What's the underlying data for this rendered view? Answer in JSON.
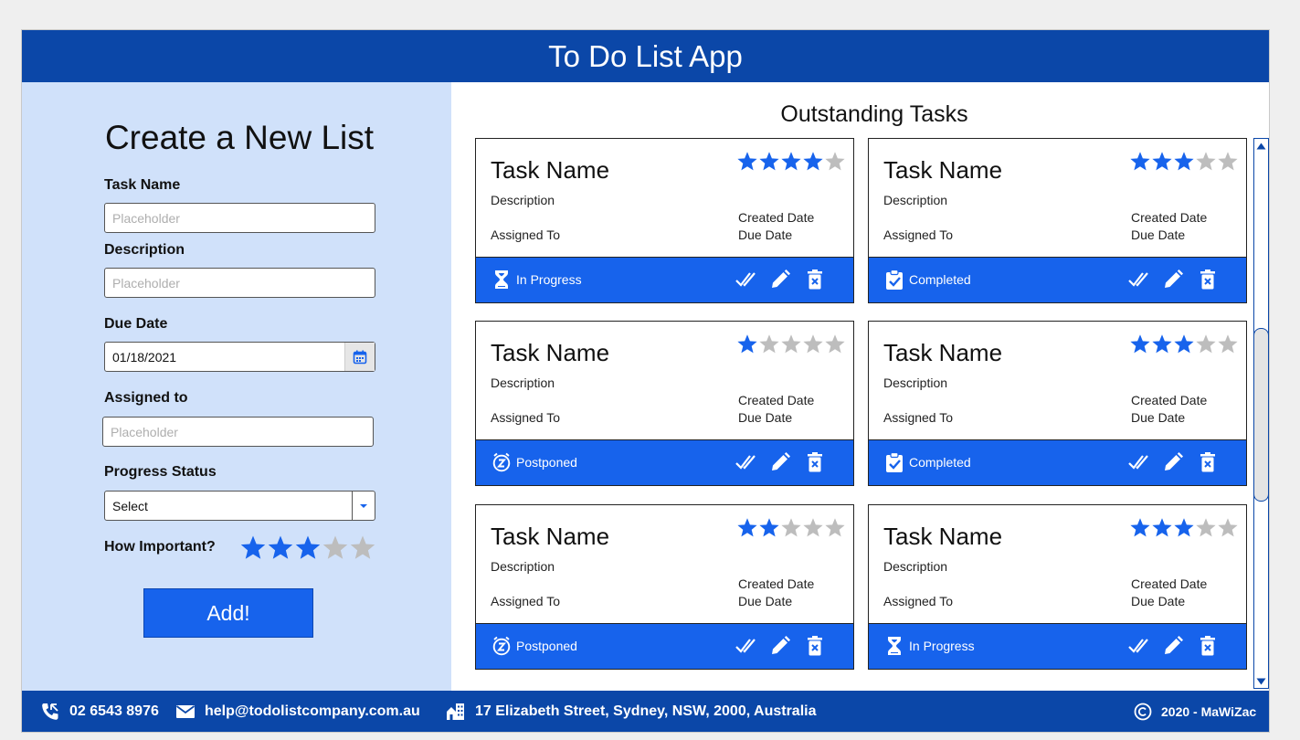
{
  "app": {
    "title": "To Do List App"
  },
  "colors": {
    "header": "#0b47a8",
    "accent": "#1763ec",
    "form_bg": "#d0e1fa",
    "star_on": "#1763ec",
    "star_off": "#bdbdbd"
  },
  "form": {
    "title": "Create a New List",
    "task_name": {
      "label": "Task Name",
      "placeholder": "Placeholder",
      "value": ""
    },
    "description": {
      "label": "Description",
      "placeholder": "Placeholder",
      "value": ""
    },
    "due_date": {
      "label": "Due Date",
      "value": "01/18/2021",
      "icon": "calendar-icon"
    },
    "assigned_to": {
      "label": "Assigned to",
      "placeholder": "Placeholder",
      "value": ""
    },
    "progress_status": {
      "label": "Progress Status",
      "value": "Select",
      "icon": "chevron-down-icon"
    },
    "importance": {
      "label": "How Important?",
      "rating": 3,
      "max": 5
    },
    "add_label": "Add!"
  },
  "tasks_panel": {
    "title": "Outstanding Tasks",
    "actions": {
      "complete_icon": "double-check-icon",
      "edit_icon": "pencil-icon",
      "delete_icon": "trash-icon"
    },
    "cards": [
      {
        "name": "Task Name",
        "description": "Description",
        "assigned_to": "Assigned To",
        "created": "Created Date",
        "due": "Due Date",
        "rating": 4,
        "status": "In Progress",
        "status_icon": "hourglass-icon"
      },
      {
        "name": "Task Name",
        "description": "Description",
        "assigned_to": "Assigned To",
        "created": "Created Date",
        "due": "Due Date",
        "rating": 3,
        "status": "Completed",
        "status_icon": "clipboard-check-icon"
      },
      {
        "name": "Task Name",
        "description": "Description",
        "assigned_to": "Assigned To",
        "created": "Created Date",
        "due": "Due Date",
        "rating": 1,
        "status": "Postponed",
        "status_icon": "snooze-clock-icon"
      },
      {
        "name": "Task Name",
        "description": "Description",
        "assigned_to": "Assigned To",
        "created": "Created Date",
        "due": "Due Date",
        "rating": 3,
        "status": "Completed",
        "status_icon": "clipboard-check-icon"
      },
      {
        "name": "Task Name",
        "description": "Description",
        "assigned_to": "Assigned To",
        "created": "Created Date",
        "due": "Due Date",
        "rating": 2,
        "status": "Postponed",
        "status_icon": "snooze-clock-icon"
      },
      {
        "name": "Task Name",
        "description": "Description",
        "assigned_to": "Assigned To",
        "created": "Created Date",
        "due": "Due Date",
        "rating": 3,
        "status": "In Progress",
        "status_icon": "hourglass-icon"
      }
    ]
  },
  "footer": {
    "phone": "02 6543 8976",
    "email": "help@todolistcompany.com.au",
    "address": "17 Elizabeth Street, Sydney, NSW, 2000, Australia",
    "copyright": "2020 - MaWiZac",
    "icons": {
      "phone": "phone-icon",
      "email": "envelope-icon",
      "address": "building-icon",
      "copyright": "copyright-icon"
    }
  }
}
